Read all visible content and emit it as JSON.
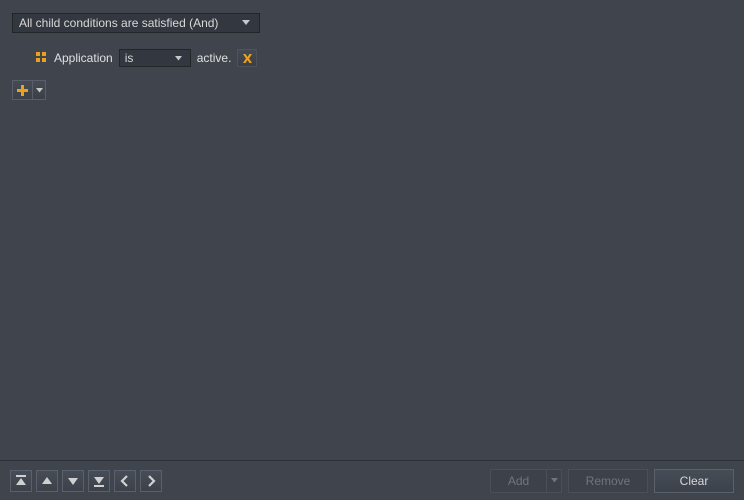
{
  "root_select": {
    "value": "All child conditions are satisfied (And)"
  },
  "condition": {
    "field_label": "Application",
    "operator_value": "is",
    "suffix_label": "active."
  },
  "buttons": {
    "add": "Add",
    "remove": "Remove",
    "clear": "Clear"
  },
  "colors": {
    "accent": "#eda11a"
  }
}
